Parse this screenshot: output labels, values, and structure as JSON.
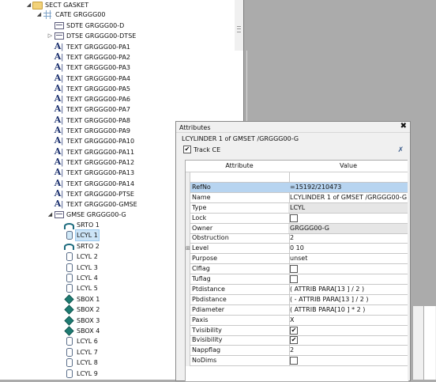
{
  "tree": {
    "root": {
      "label": "SECT GASKET",
      "icon": "folder-icon"
    },
    "cate": {
      "label": "CATE GRGGG00",
      "icon": "catalogue-icon"
    },
    "cate_children": [
      {
        "label": "SDTE GRGGG00-D",
        "icon": "datum-table-icon",
        "expander": ""
      },
      {
        "label": "DTSE GRGGG00-DTSE",
        "icon": "datum-table-icon",
        "expander": "▷"
      },
      {
        "label": "TEXT GRGGG00-PA1",
        "icon": "text-icon"
      },
      {
        "label": "TEXT GRGGG00-PA2",
        "icon": "text-icon"
      },
      {
        "label": "TEXT GRGGG00-PA3",
        "icon": "text-icon"
      },
      {
        "label": "TEXT GRGGG00-PA4",
        "icon": "text-icon"
      },
      {
        "label": "TEXT GRGGG00-PA5",
        "icon": "text-icon"
      },
      {
        "label": "TEXT GRGGG00-PA6",
        "icon": "text-icon"
      },
      {
        "label": "TEXT GRGGG00-PA7",
        "icon": "text-icon"
      },
      {
        "label": "TEXT GRGGG00-PA8",
        "icon": "text-icon"
      },
      {
        "label": "TEXT GRGGG00-PA9",
        "icon": "text-icon"
      },
      {
        "label": "TEXT GRGGG00-PA10",
        "icon": "text-icon"
      },
      {
        "label": "TEXT GRGGG00-PA11",
        "icon": "text-icon"
      },
      {
        "label": "TEXT GRGGG00-PA12",
        "icon": "text-icon"
      },
      {
        "label": "TEXT GRGGG00-PA13",
        "icon": "text-icon"
      },
      {
        "label": "TEXT GRGGG00-PA14",
        "icon": "text-icon"
      },
      {
        "label": "TEXT GRGGG00-PTSE",
        "icon": "text-icon"
      },
      {
        "label": "TEXT GRGGG00-GMSE",
        "icon": "text-icon"
      },
      {
        "label": "GMSE GRGGG00-G",
        "icon": "geomset-icon",
        "expander": "◢"
      }
    ],
    "gmse_children": [
      {
        "label": "SRTO 1",
        "icon": "torus-icon"
      },
      {
        "label": "LCYL 1",
        "icon": "cylinder-icon",
        "selected": true
      },
      {
        "label": "SRTO 2",
        "icon": "torus-icon"
      },
      {
        "label": "LCYL 2",
        "icon": "cylinder-icon"
      },
      {
        "label": "LCYL 3",
        "icon": "cylinder-icon"
      },
      {
        "label": "LCYL 4",
        "icon": "cylinder-icon"
      },
      {
        "label": "LCYL 5",
        "icon": "cylinder-icon"
      },
      {
        "label": "SBOX 1",
        "icon": "box-icon"
      },
      {
        "label": "SBOX 2",
        "icon": "box-icon"
      },
      {
        "label": "SBOX 3",
        "icon": "box-icon"
      },
      {
        "label": "SBOX 4",
        "icon": "box-icon"
      },
      {
        "label": "LCYL 6",
        "icon": "cylinder-icon"
      },
      {
        "label": "LCYL 7",
        "icon": "cylinder-icon"
      },
      {
        "label": "LCYL 8",
        "icon": "cylinder-icon"
      },
      {
        "label": "LCYL 9",
        "icon": "cylinder-icon"
      }
    ]
  },
  "attributes": {
    "title": "Attributes",
    "close": "✖",
    "heading": "LCYLINDER 1 of GMSET /GRGGG00-G",
    "track_ce_label": "Track CE",
    "track_ce_checked": "✔",
    "columns": {
      "attribute": "Attribute",
      "value": "Value"
    },
    "rows": [
      {
        "name": "",
        "value": ""
      },
      {
        "name": "RefNo",
        "value": "=15192/210473",
        "highlight": true
      },
      {
        "name": "Name",
        "value": "LCYLINDER 1 of GMSET /GRGGG00-G"
      },
      {
        "name": "Type",
        "value": "LCYL",
        "readonly": true
      },
      {
        "name": "Lock",
        "value": "",
        "checkbox": true,
        "checked": false
      },
      {
        "name": "Owner",
        "value": "GRGGG00-G",
        "readonly": true
      },
      {
        "name": "Obstruction",
        "value": "2"
      },
      {
        "name": "Level",
        "value": "0 10",
        "expander": "⊞"
      },
      {
        "name": "Purpose",
        "value": "unset"
      },
      {
        "name": "Clflag",
        "value": "",
        "checkbox": true,
        "checked": false
      },
      {
        "name": "Tuflag",
        "value": "",
        "checkbox": true,
        "checked": false
      },
      {
        "name": "Ptdistance",
        "value": "( ATTRIB PARA[13 ] / 2 )"
      },
      {
        "name": "Pbdistance",
        "value": "( - ATTRIB PARA[13 ] / 2 )"
      },
      {
        "name": "Pdiameter",
        "value": "( ATTRIB PARA[10 ] * 2 )"
      },
      {
        "name": "Paxis",
        "value": "X"
      },
      {
        "name": "Tvisibility",
        "value": "",
        "checkbox": true,
        "checked": true
      },
      {
        "name": "Bvisibility",
        "value": "",
        "checkbox": true,
        "checked": true
      },
      {
        "name": "Nappflag",
        "value": "2"
      },
      {
        "name": "NoDims",
        "value": "",
        "checkbox": true,
        "checked": false
      }
    ]
  }
}
